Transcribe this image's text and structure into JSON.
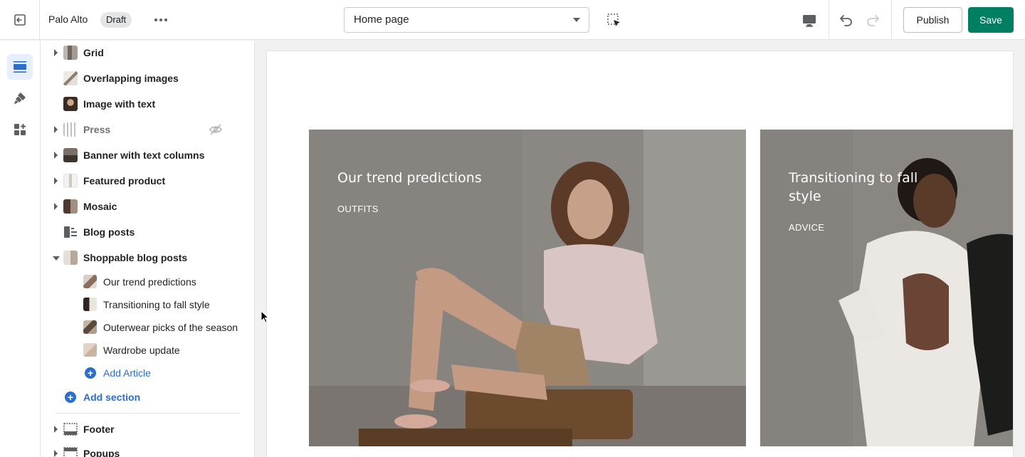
{
  "topbar": {
    "store_name": "Palo Alto",
    "status_badge": "Draft",
    "page_selector": {
      "value": "Home page"
    },
    "publish_label": "Publish",
    "save_label": "Save"
  },
  "rail": {
    "items": [
      {
        "icon": "sections-icon",
        "active": true
      },
      {
        "icon": "theme-settings-brush-icon",
        "active": false
      },
      {
        "icon": "app-embeds-icon",
        "active": false
      }
    ]
  },
  "sidebar": {
    "sections": [
      {
        "label": "Grid",
        "expandable": true
      },
      {
        "label": "Overlapping images",
        "expandable": false
      },
      {
        "label": "Image with text",
        "expandable": false
      },
      {
        "label": "Press",
        "expandable": true,
        "hidden": true
      },
      {
        "label": "Banner with text columns",
        "expandable": true
      },
      {
        "label": "Featured product",
        "expandable": true
      },
      {
        "label": "Mosaic",
        "expandable": true
      },
      {
        "label": "Blog posts",
        "expandable": false
      },
      {
        "label": "Shoppable blog posts",
        "expandable": true,
        "expanded": true
      }
    ],
    "articles": [
      {
        "label": "Our trend predictions"
      },
      {
        "label": "Transitioning to fall style"
      },
      {
        "label": "Outerwear picks of the season"
      },
      {
        "label": "Wardrobe update"
      }
    ],
    "add_article_label": "Add Article",
    "add_section_label": "Add section",
    "footer_sections": [
      {
        "label": "Footer",
        "expandable": true
      },
      {
        "label": "Popups",
        "expandable": true
      }
    ]
  },
  "preview": {
    "cards": [
      {
        "title": "Our trend predictions",
        "tag": "OUTFITS"
      },
      {
        "title": "Transitioning to fall style",
        "tag": "ADVICE"
      }
    ]
  },
  "colors": {
    "accent": "#2c6ecb",
    "save": "#008060",
    "rail_active": "#e5effd"
  }
}
